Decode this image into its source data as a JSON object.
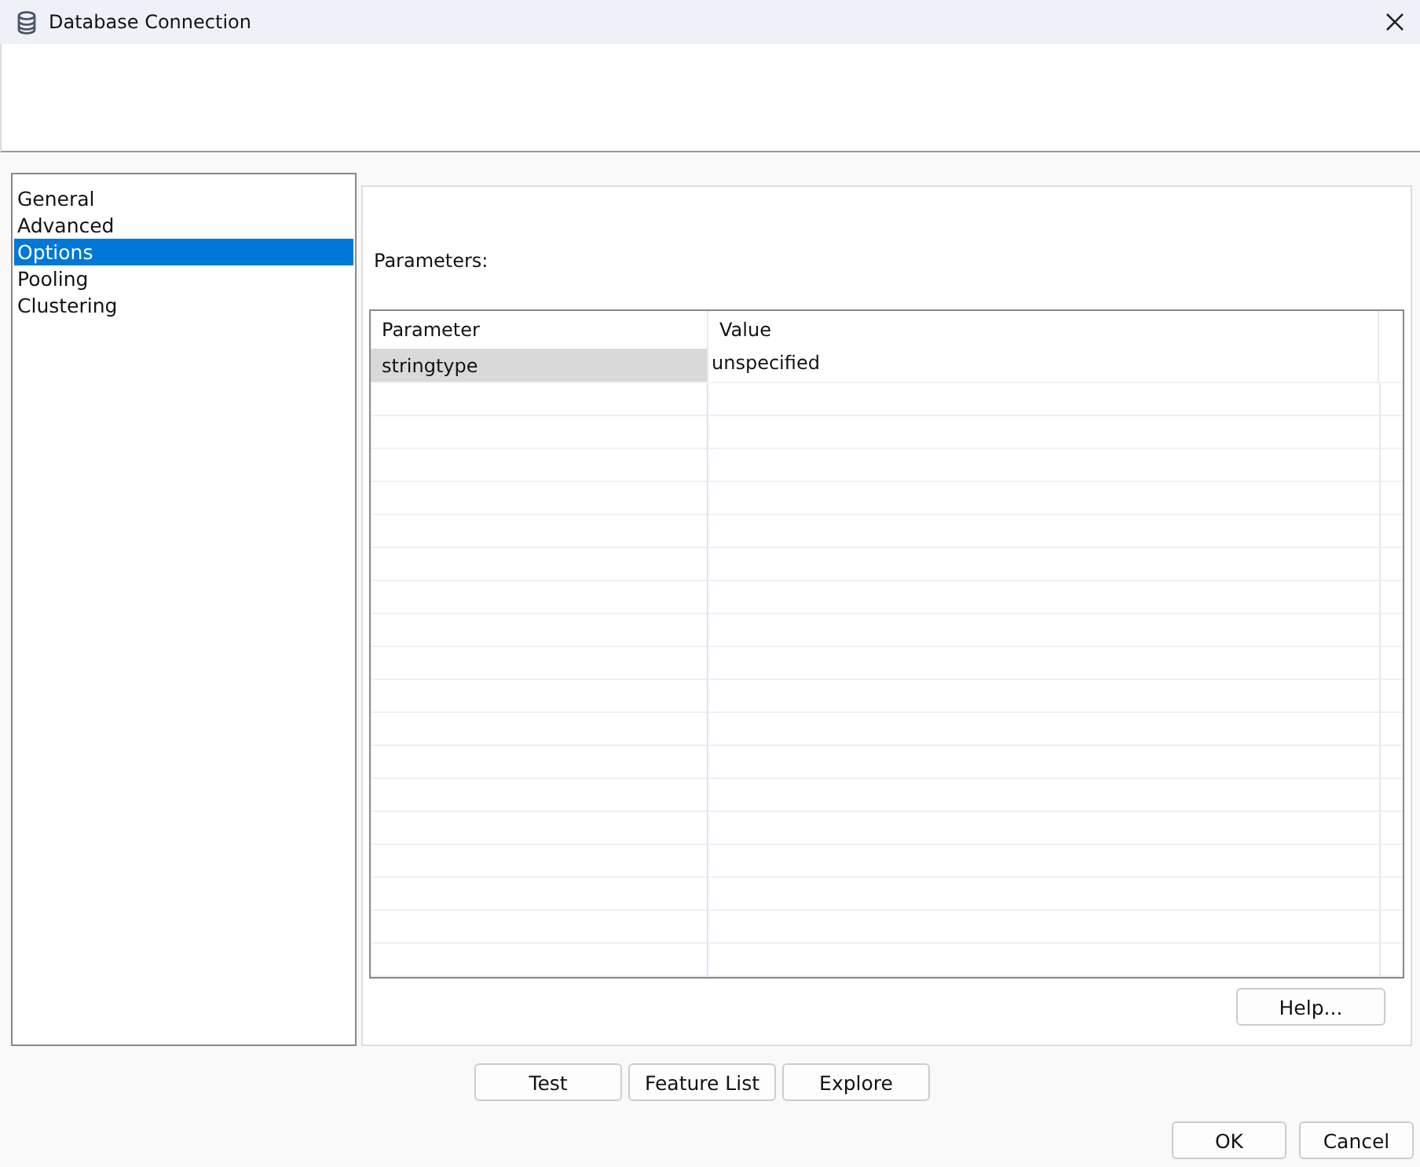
{
  "window": {
    "title": "Database Connection"
  },
  "sidebar": {
    "items": [
      {
        "label": "General",
        "selected": false
      },
      {
        "label": "Advanced",
        "selected": false
      },
      {
        "label": "Options",
        "selected": true
      },
      {
        "label": "Pooling",
        "selected": false
      },
      {
        "label": "Clustering",
        "selected": false
      }
    ]
  },
  "parameters_label": "Parameters:",
  "table": {
    "columns": [
      "Parameter",
      "Value"
    ],
    "rows": [
      {
        "cells": [
          "stringtype",
          "unspecified"
        ],
        "selected": true
      }
    ]
  },
  "help_button": "Help...",
  "action_buttons": [
    "Test",
    "Feature List",
    "Explore"
  ],
  "dialog_buttons": [
    "OK",
    "Cancel"
  ]
}
